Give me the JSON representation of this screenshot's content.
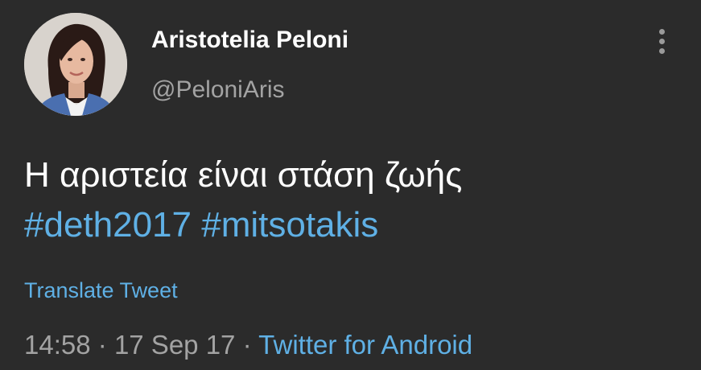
{
  "user": {
    "display_name": "Aristotelia Peloni",
    "handle": "@PeloniAris"
  },
  "tweet": {
    "text": "Η αριστεία είναι στάση ζωής",
    "hashtags": [
      "#deth2017",
      "#mitsotakis"
    ],
    "translate_label": "Translate Tweet",
    "time": "14:58",
    "date": "17 Sep 17",
    "separator": "·",
    "source": "Twitter for Android"
  },
  "icons": {
    "more": "more-vertical-icon",
    "avatar": "avatar"
  },
  "colors": {
    "background": "#2b2b2b",
    "text_primary": "#ffffff",
    "text_secondary": "#a3a3a3",
    "link": "#5fb0e5"
  }
}
